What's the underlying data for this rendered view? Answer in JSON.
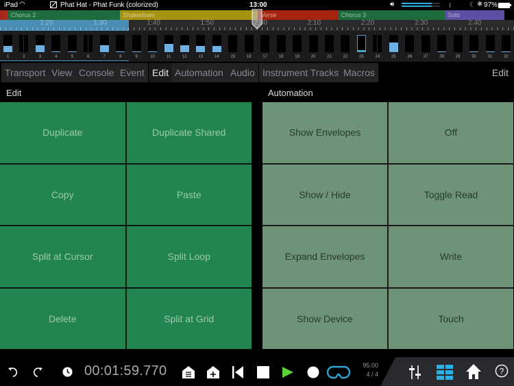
{
  "status_bar": {
    "device": "iPad",
    "wifi_icon": "wifi-icon",
    "document_title": "Phat Hat - Phat Funk (colorized)",
    "time": "13:00",
    "volume_level": 0.78,
    "battery_percent": "97%"
  },
  "arranger": {
    "sections": [
      {
        "label": "",
        "color": "#a52a1a",
        "start_sec": 71.3,
        "end_sec": 72.8
      },
      {
        "label": "Chorus 2",
        "color": "#1d6b3c",
        "start_sec": 72.8,
        "end_sec": 93.7
      },
      {
        "label": "Shakedown",
        "color": "#a69312",
        "start_sec": 93.7,
        "end_sec": 119.5
      },
      {
        "label": "Verse",
        "color": "#a5230f",
        "start_sec": 119.5,
        "end_sec": 134.5
      },
      {
        "label": "Chorus 3",
        "color": "#1d6b3c",
        "start_sec": 134.5,
        "end_sec": 154.4
      },
      {
        "label": "Solo",
        "color": "#5c4fa6",
        "start_sec": 154.4,
        "end_sec": 165.5
      }
    ],
    "ruler_labels": [
      "1:20",
      "1:30",
      "1:40",
      "1:50",
      "2:00",
      "2:10",
      "2:20",
      "2:30",
      "2:40"
    ],
    "playhead_time": "2:00"
  },
  "markers": {
    "items": [
      {
        "n": "1",
        "level": 0.35,
        "split": false
      },
      {
        "n": "2",
        "level": 0,
        "split": true
      },
      {
        "n": "3",
        "level": 0.4,
        "split": false
      },
      {
        "n": "4",
        "level": 0.06,
        "split": false
      },
      {
        "n": "5",
        "level": 0.06,
        "split": false
      },
      {
        "n": "6",
        "level": 0,
        "split": true
      },
      {
        "n": "7",
        "level": 0.4,
        "split": false
      },
      {
        "n": "8",
        "level": 0.06,
        "split": false
      },
      {
        "n": "9",
        "level": 0.06,
        "split": false
      },
      {
        "n": "10",
        "level": 0.04,
        "split": false
      },
      {
        "n": "11",
        "level": 0.5,
        "split": false
      },
      {
        "n": "12",
        "level": 0.42,
        "split": false
      },
      {
        "n": "13",
        "level": 0.38,
        "split": false
      },
      {
        "n": "14",
        "level": 0.36,
        "split": false
      },
      {
        "n": "15",
        "level": 0,
        "split": false
      },
      {
        "n": "16",
        "level": 0,
        "split": false
      },
      {
        "n": "17",
        "level": 0,
        "split": false
      },
      {
        "n": "18",
        "level": 0,
        "split": false
      },
      {
        "n": "19",
        "level": 0,
        "split": false
      },
      {
        "n": "20",
        "level": 0,
        "split": false
      },
      {
        "n": "21",
        "level": 0,
        "split": false
      },
      {
        "n": "22",
        "level": 0,
        "split": false
      },
      {
        "n": "23",
        "level": 0,
        "split": false,
        "selected": true
      },
      {
        "n": "24",
        "level": 0,
        "split": true
      },
      {
        "n": "25",
        "level": 0.55,
        "split": false
      },
      {
        "n": "26",
        "level": 0,
        "split": false
      },
      {
        "n": "27",
        "level": 0,
        "split": false
      },
      {
        "n": "28",
        "level": 0.06,
        "split": false
      },
      {
        "n": "29",
        "level": 0,
        "split": false
      },
      {
        "n": "30",
        "level": 0.04,
        "split": false
      },
      {
        "n": "31",
        "level": 0.04,
        "split": false
      },
      {
        "n": "32",
        "level": 0.06,
        "split": false
      }
    ]
  },
  "tabs": {
    "items": [
      {
        "label": "Transport",
        "active": false
      },
      {
        "label": "View",
        "active": false
      },
      {
        "label": "Console",
        "active": false
      },
      {
        "label": "Event",
        "active": false
      },
      {
        "label": "Edit",
        "active": true
      },
      {
        "label": "Automation",
        "active": false
      },
      {
        "label": "Audio",
        "active": false
      },
      {
        "label": "Instrument Tracks",
        "active": false
      },
      {
        "label": "Macros",
        "active": false
      }
    ],
    "right_label": "Edit"
  },
  "edit_panel": {
    "title": "Edit",
    "buttons": [
      "Duplicate",
      "Duplicate Shared",
      "Copy",
      "Paste",
      "Split at Cursor",
      "Split Loop",
      "Delete",
      "Split at Grid"
    ]
  },
  "automation_panel": {
    "title": "Automation",
    "buttons": [
      "Show Envelopes",
      "Off",
      "Show / Hide",
      "Toggle Read",
      "Expand Envelopes",
      "Write",
      "Show Device",
      "Touch"
    ]
  },
  "transport": {
    "time": "00:01:59.770",
    "tempo": "95.00",
    "signature": "4 / 4",
    "play_color": "#5fd23a",
    "loop_color": "#2aa8d8",
    "accent": "#2ab2e6"
  }
}
